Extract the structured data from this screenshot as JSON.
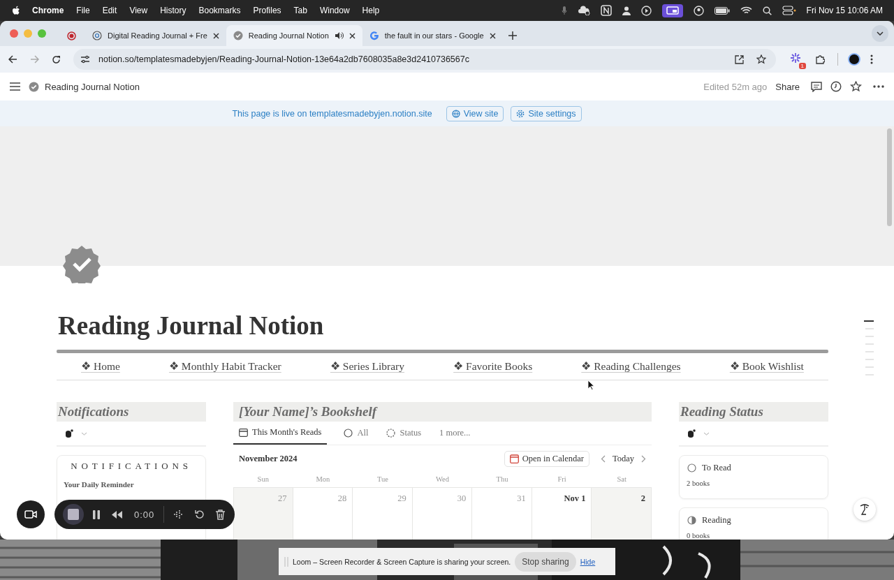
{
  "menubar": {
    "app": "Chrome",
    "menus": [
      "File",
      "Edit",
      "View",
      "History",
      "Bookmarks",
      "Profiles",
      "Tab",
      "Window",
      "Help"
    ],
    "clock": "Fri Nov 15  10:06 AM"
  },
  "tabs": [
    {
      "kind": "recording",
      "selected": false,
      "audio": false
    },
    {
      "title": "Digital Reading Journal + Fre",
      "kind": "site",
      "selected": false,
      "audio": false
    },
    {
      "title": "Reading Journal Notion",
      "kind": "notion",
      "selected": true,
      "audio": true
    },
    {
      "title": "the fault in our stars - Google",
      "kind": "google",
      "selected": false,
      "audio": false
    }
  ],
  "address_bar": {
    "url": "notion.so/templatesmadebyjen/Reading-Journal-Notion-13e64a2db7608035a8e3d2410736567c",
    "extension_badge": "1"
  },
  "notion_topbar": {
    "breadcrumb": "Reading Journal Notion",
    "edited": "Edited 52m ago",
    "share": "Share"
  },
  "banner": {
    "text": "This page is live on templatesmadebyjen.notion.site",
    "buttons": [
      {
        "label": "View site",
        "kind": "globe"
      },
      {
        "label": "Site settings",
        "kind": "gear"
      }
    ]
  },
  "page": {
    "title": "Reading Journal Notion",
    "nav": [
      "❖ Home",
      "❖ Monthly Habit Tracker",
      "❖ Series Library",
      "❖ Favorite Books",
      "❖ Reading Challenges",
      "❖ Book Wishlist"
    ]
  },
  "notifications": {
    "heading": "Notifications",
    "card_title": "NOTIFICATIONS",
    "reminder": "Your Daily Reminder"
  },
  "bookshelf": {
    "heading": "[Your Name]’s Bookshelf",
    "views": [
      {
        "label": "This Month's Reads",
        "kind": "calendar",
        "selected": true
      },
      {
        "label": "All",
        "kind": "circle",
        "selected": false
      },
      {
        "label": "Status",
        "kind": "dashed",
        "selected": false
      }
    ],
    "more": "1 more...",
    "month": "November 2024",
    "open_calendar": "Open in Calendar",
    "today": "Today",
    "weekdays": [
      "Sun",
      "Mon",
      "Tue",
      "Wed",
      "Thu",
      "Fri",
      "Sat"
    ],
    "days": [
      {
        "label": "27",
        "in_month": false
      },
      {
        "label": "28",
        "in_month": false
      },
      {
        "label": "29",
        "in_month": false
      },
      {
        "label": "30",
        "in_month": false
      },
      {
        "label": "31",
        "in_month": false
      },
      {
        "label": "Nov 1",
        "in_month": true
      },
      {
        "label": "2",
        "in_month": true
      }
    ]
  },
  "reading_status": {
    "heading": "Reading Status",
    "cards": [
      {
        "name": "To Read",
        "count": "2 books",
        "kind": "empty"
      },
      {
        "name": "Reading",
        "count": "0 books",
        "kind": "half"
      }
    ]
  },
  "loom_recorder": {
    "time": "0:00"
  },
  "loom_share_bar": {
    "text": "Loom – Screen Recorder & Screen Capture is sharing your screen.",
    "stop": "Stop sharing",
    "hide": "Hide"
  }
}
